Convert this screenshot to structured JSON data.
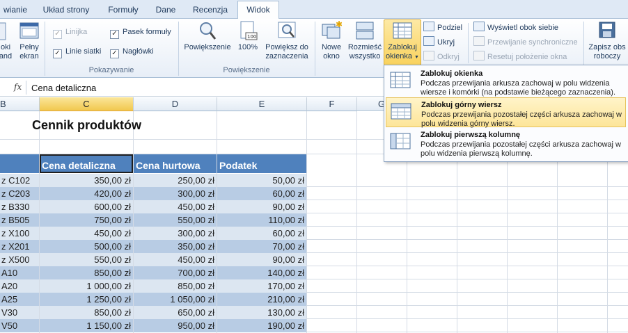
{
  "tabs": [
    "wianie",
    "Układ strony",
    "Formuły",
    "Dane",
    "Recenzja",
    "Widok"
  ],
  "ribbon": {
    "left_partial_1": "oki",
    "left_partial_2": "and",
    "pelny_ekran_1": "Pełny",
    "pelny_ekran_2": "ekran",
    "chk_linijka": "Linijka",
    "chk_linie": "Linie siatki",
    "chk_pasek": "Pasek formuły",
    "chk_naglowki": "Nagłówki",
    "group_pokazywanie": "Pokazywanie",
    "powiekszenie": "Powiększenie",
    "zoom100": "100%",
    "powieksz_1": "Powiększ do",
    "powieksz_2": "zaznaczenia",
    "group_powiekszenie": "Powiększenie",
    "nowe_1": "Nowe",
    "nowe_2": "okno",
    "rozmiesc_1": "Rozmieść",
    "rozmiesc_2": "wszystko",
    "zablokuj_1": "Zablokuj",
    "zablokuj_2": "okienka",
    "podziel": "Podziel",
    "ukryj": "Ukryj",
    "odkryj": "Odkryj",
    "obok": "Wyświetl obok siebie",
    "przewijanie": "Przewijanie synchroniczne",
    "resetuj": "Resetuj położenie okna",
    "zapisz_1": "Zapisz obs",
    "zapisz_2": "roboczy"
  },
  "formula_bar": {
    "fx": "fx",
    "value": "Cena detaliczna"
  },
  "columns": [
    "B",
    "C",
    "D",
    "E",
    "F",
    "G"
  ],
  "sheet": {
    "title": "Cennik produktów",
    "headers": [
      "Cena detaliczna",
      "Cena hurtowa",
      "Podatek"
    ],
    "rows": [
      {
        "name": "z C102",
        "v1": "350,00 zł",
        "v2": "250,00 zł",
        "v3": "50,00 zł"
      },
      {
        "name": "z C203",
        "v1": "420,00 zł",
        "v2": "300,00 zł",
        "v3": "60,00 zł"
      },
      {
        "name": "z B330",
        "v1": "600,00 zł",
        "v2": "450,00 zł",
        "v3": "90,00 zł"
      },
      {
        "name": "z B505",
        "v1": "750,00 zł",
        "v2": "550,00 zł",
        "v3": "110,00 zł"
      },
      {
        "name": "z X100",
        "v1": "450,00 zł",
        "v2": "300,00 zł",
        "v3": "60,00 zł"
      },
      {
        "name": "z X201",
        "v1": "500,00 zł",
        "v2": "350,00 zł",
        "v3": "70,00 zł"
      },
      {
        "name": "z X500",
        "v1": "550,00 zł",
        "v2": "450,00 zł",
        "v3": "90,00 zł"
      },
      {
        "name": "A10",
        "v1": "850,00 zł",
        "v2": "700,00 zł",
        "v3": "140,00 zł"
      },
      {
        "name": "A20",
        "v1": "1 000,00 zł",
        "v2": "850,00 zł",
        "v3": "170,00 zł"
      },
      {
        "name": "A25",
        "v1": "1 250,00 zł",
        "v2": "1 050,00 zł",
        "v3": "210,00 zł"
      },
      {
        "name": "V30",
        "v1": "850,00 zł",
        "v2": "650,00 zł",
        "v3": "130,00 zł"
      },
      {
        "name": "V50",
        "v1": "1 150,00 zł",
        "v2": "950,00 zł",
        "v3": "190,00 zł"
      }
    ]
  },
  "menu": {
    "items": [
      {
        "title": "Zablokuj okienka",
        "desc": "Podczas przewijania arkusza zachowaj w polu widzenia wiersze i komórki (na podstawie bieżącego zaznaczenia)."
      },
      {
        "title": "Zablokuj górny wiersz",
        "desc": "Podczas przewijania pozostałej części arkusza zachowaj w polu widzenia górny wiersz."
      },
      {
        "title": "Zablokuj pierwszą kolumnę",
        "desc": "Podczas przewijania pozostałej części arkusza zachowaj w polu widzenia pierwszą kolumnę."
      }
    ]
  },
  "colors": {
    "header_blue": "#4f81bd",
    "band_light": "#dce6f1",
    "band_dark": "#b8cce4",
    "highlight": "#fde599"
  }
}
